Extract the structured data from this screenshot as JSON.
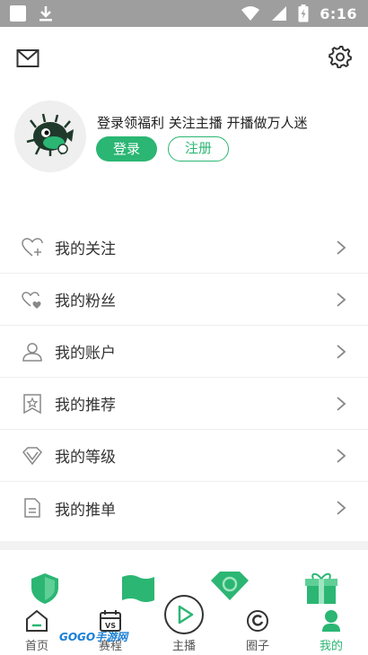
{
  "status_bar": {
    "time": "6:16",
    "left_icons": [
      "photo-icon",
      "download-icon"
    ],
    "right_icons": [
      "wifi-icon",
      "signal-icon",
      "battery-icon"
    ]
  },
  "header": {
    "left_icon": "mail-icon",
    "right_icon": "gear-icon"
  },
  "profile": {
    "promo_text": "登录领福利 关注主播 开播做万人迷",
    "login_label": "登录",
    "register_label": "注册"
  },
  "menu": {
    "items": [
      {
        "label": "我的关注",
        "icon": "heart-plus-icon"
      },
      {
        "label": "我的粉丝",
        "icon": "hearts-icon"
      },
      {
        "label": "我的账户",
        "icon": "user-icon"
      },
      {
        "label": "我的推荐",
        "icon": "bookmark-star-icon"
      },
      {
        "label": "我的等级",
        "icon": "diamond-icon"
      },
      {
        "label": "我的推单",
        "icon": "document-icon"
      }
    ]
  },
  "tabbar": {
    "tabs": [
      {
        "label": "首页",
        "icon": "home-icon",
        "active": false
      },
      {
        "label": "赛程",
        "icon": "calendar-vs-icon",
        "active": false
      },
      {
        "label": "主播",
        "icon": "play-icon",
        "active": false
      },
      {
        "label": "圈子",
        "icon": "circle-icon",
        "active": false
      },
      {
        "label": "我的",
        "icon": "person-icon",
        "active": true
      }
    ],
    "watermark": "GOGO手游网"
  },
  "colors": {
    "accent": "#2bb673",
    "status_bar": "#9e9e9e",
    "text": "#333333"
  }
}
